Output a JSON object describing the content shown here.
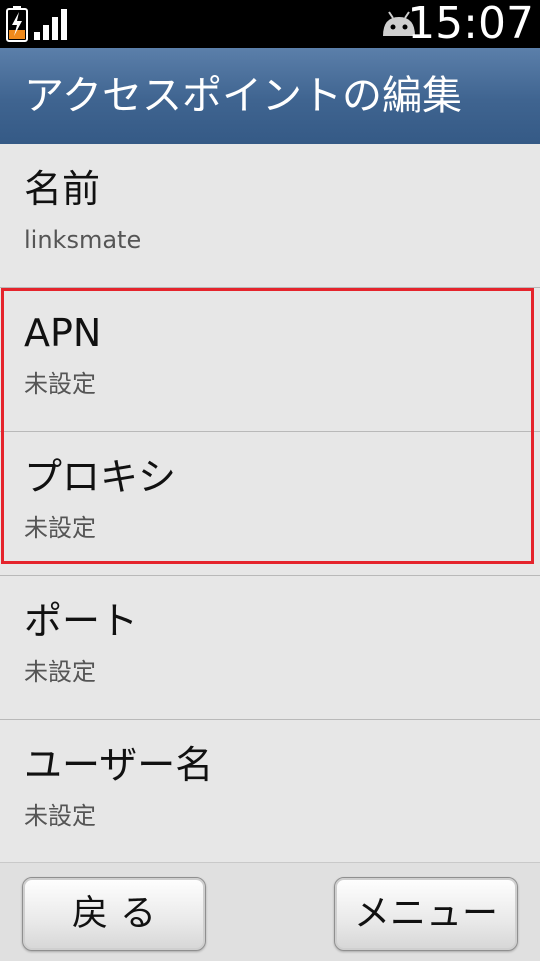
{
  "status_bar": {
    "time": "15:07",
    "icons": [
      "battery-charging-icon",
      "signal-strength-icon",
      "android-notification-icon"
    ],
    "battery_color": "#f08a1c"
  },
  "header": {
    "title": "アクセスポイントの編集",
    "background": "#3f6490"
  },
  "settings": {
    "items": [
      {
        "label": "名前",
        "value": "linksmate"
      },
      {
        "label": "APN",
        "value": "未設定"
      },
      {
        "label": "プロキシ",
        "value": "未設定"
      },
      {
        "label": "ポート",
        "value": "未設定"
      },
      {
        "label": "ユーザー名",
        "value": "未設定"
      }
    ],
    "highlight_color": "#e5242c"
  },
  "footer": {
    "back_label": "戻る",
    "menu_label": "メニュー"
  }
}
